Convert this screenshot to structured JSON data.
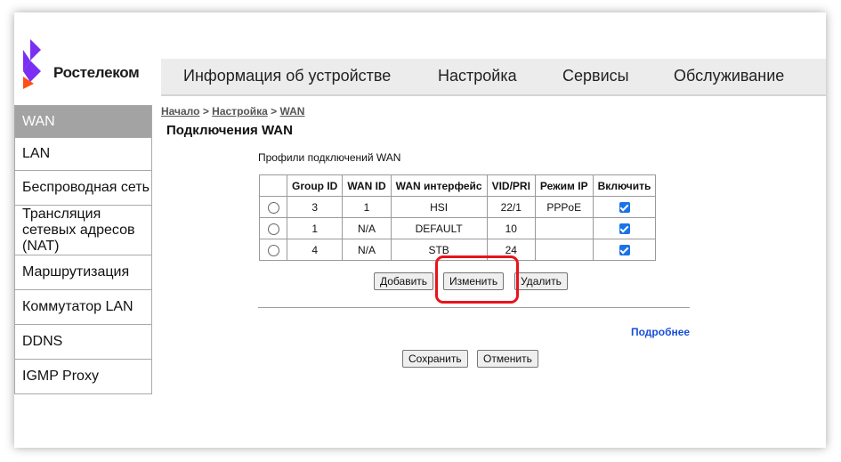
{
  "brand": {
    "name": "Ростелеком"
  },
  "topnav": [
    {
      "label": "Информация об устройстве"
    },
    {
      "label": "Настройка"
    },
    {
      "label": "Сервисы"
    },
    {
      "label": "Обслуживание"
    }
  ],
  "sidebar": [
    {
      "label": "WAN",
      "active": true
    },
    {
      "label": "LAN"
    },
    {
      "label": "Беспроводная сеть"
    },
    {
      "label": "Трансляция сетевых адресов (NAT)"
    },
    {
      "label": "Маршрутизация"
    },
    {
      "label": "Коммутатор LAN"
    },
    {
      "label": "DDNS"
    },
    {
      "label": "IGMP Proxy"
    }
  ],
  "breadcrumb": {
    "home": "Начало",
    "sep1": " > ",
    "settings": "Настройка",
    "sep2": " > ",
    "current": "WAN"
  },
  "page_title": "Подключения WAN",
  "section_label": "Профили подключений WAN",
  "table": {
    "headers": [
      "",
      "Group ID",
      "WAN ID",
      "WAN интерфейс",
      "VID/PRI",
      "Режим IP",
      "Включить"
    ],
    "rows": [
      {
        "group_id": "3",
        "wan_id": "1",
        "iface": "HSI",
        "vid": "22/1",
        "mode": "PPPoE",
        "enabled": true
      },
      {
        "group_id": "1",
        "wan_id": "N/A",
        "iface": "DEFAULT",
        "vid": "10",
        "mode": "",
        "enabled": true
      },
      {
        "group_id": "4",
        "wan_id": "N/A",
        "iface": "STB",
        "vid": "24",
        "mode": "",
        "enabled": true
      }
    ]
  },
  "buttons": {
    "add": "Добавить",
    "edit": "Изменить",
    "delete": "Удалить",
    "save": "Сохранить",
    "cancel": "Отменить"
  },
  "more_link": "Подробнее",
  "colors": {
    "accent_highlight": "#e8141b",
    "brand_purple": "#7a2ff2",
    "brand_orange": "#ff4f12",
    "link_blue": "#1a4ed8"
  }
}
